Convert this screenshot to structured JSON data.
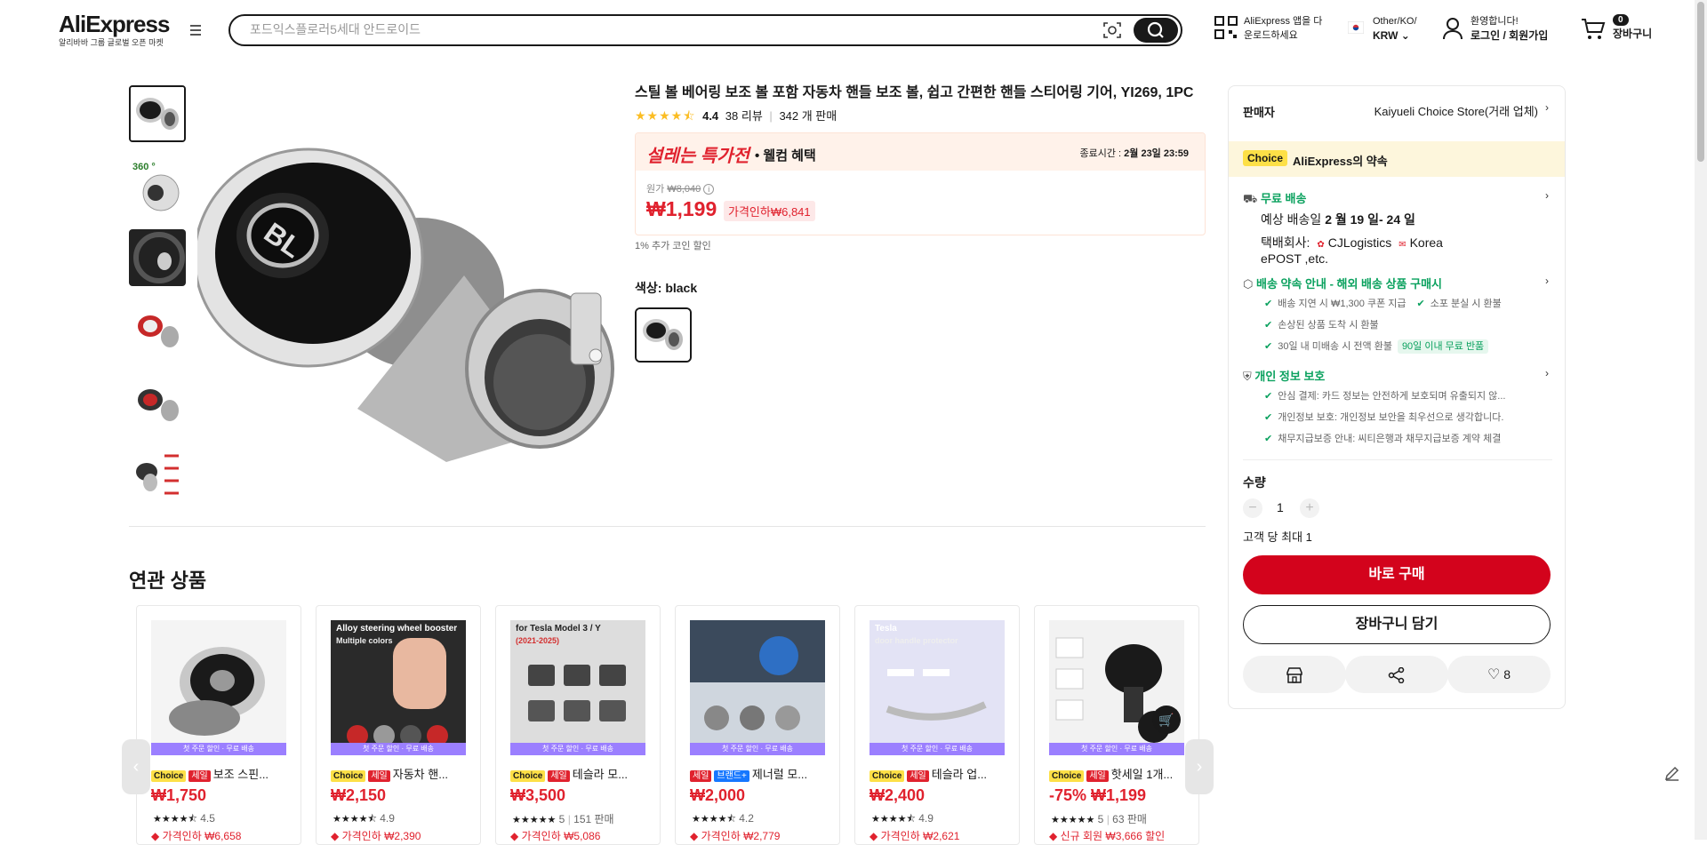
{
  "header": {
    "logo": "AliExpress",
    "logo_sub": "알리바바 그룹 글로벌 오픈 마켓",
    "search_placeholder": "포드익스플로러5세대 안드로이드",
    "app_line1": "AliExpress 앱을 다",
    "app_line2": "운로드하세요",
    "locale_line1": "Other/KO/",
    "locale_line2": "KRW",
    "account_line1": "환영합니다!",
    "account_line2": "로그인 / 회원가입",
    "cart_count": "0",
    "cart_label": "장바구니"
  },
  "product": {
    "title": "스틸 볼 베어링 보조 볼 포함 자동차 핸들 보조 볼, 쉽고 간편한 핸들 스티어링 기어, YI269, 1PC",
    "rating": "4.4",
    "stars": "★★★★⯪",
    "reviews": "38 리뷰",
    "sold": "342 개 판매",
    "promo_logo": "설레는 특가전",
    "promo_tag": "• 웰컴 혜택",
    "promo_end_label": "종료시간 :",
    "promo_end_time": "2월 23일 23:59",
    "original_label": "원가",
    "original_price": "₩8,040",
    "price": "₩1,199",
    "discount": "가격인하₩6,841",
    "coin": "1% 추가 코인 할인",
    "color_label": "색상:",
    "color_value": "black"
  },
  "panel": {
    "seller_label": "판매자",
    "seller_name": "Kaiyueli Choice Store(거래 업체)",
    "choice_badge": "Choice",
    "promise": "AliExpress의 약속",
    "shipping_title": "무료 배송",
    "eta_label": "예상 배송일",
    "eta": "2 월 19 일- 24 일",
    "carrier_label": "택배회사:",
    "carrier1": "CJLogistics",
    "carrier2": "Korea",
    "carrier3": "ePOST ,etc.",
    "guarantee_title": "배송 약속 안내 - 해외 배송 상품 구매시",
    "g1": "배송 지연 시 ₩1,300 쿠폰 지급",
    "g2": "소포 분실 시 환불",
    "g3": "손상된 상품 도착 시 환불",
    "g4": "30일 내 미배송 시 전액 환불",
    "g4_tag": "90일 이내 무료 반품",
    "privacy_title": "개인 정보 보호",
    "p1": "안심 결제: 카드 정보는 안전하게 보호되며 유출되지 않...",
    "p2": "개인정보 보호: 개인정보 보안을 최우선으로 생각합니다.",
    "p3": "채무지급보증 안내: 씨티은행과 채무지급보증 계약 체결",
    "qty_label": "수량",
    "qty_minus": "−",
    "qty_value": "1",
    "qty_plus": "+",
    "qty_limit": "고객 당 최대 1",
    "buy_now": "바로 구매",
    "add_cart": "장바구니 담기",
    "wish_count": "8"
  },
  "related": {
    "title": "연관 상품",
    "strip": "첫 주문 할인 · 무료 배송",
    "items": [
      {
        "badges": [
          "Choice",
          "세일"
        ],
        "name": "보조 스핀...",
        "price": "₩1,750",
        "stars": "★★★★⯪",
        "rating": "4.5",
        "sold": "",
        "sub": "가격인하 ₩6,658"
      },
      {
        "badges": [
          "Choice",
          "세일"
        ],
        "name": "자동차 핸...",
        "price": "₩2,150",
        "stars": "★★★★⯪",
        "rating": "4.9",
        "sold": "",
        "sub": "가격인하 ₩2,390"
      },
      {
        "badges": [
          "Choice",
          "세일"
        ],
        "name": "테슬라 모...",
        "price": "₩3,500",
        "stars": "★★★★★",
        "rating": "5",
        "sold": "151 판매",
        "sub": "가격인하 ₩5,086"
      },
      {
        "badges": [
          "세일",
          "브랜드+"
        ],
        "name": "제너럴 모...",
        "price": "₩2,000",
        "stars": "★★★★⯪",
        "rating": "4.2",
        "sold": "",
        "sub": "가격인하 ₩2,779"
      },
      {
        "badges": [
          "Choice",
          "세일"
        ],
        "name": "테슬라 업...",
        "price": "₩2,400",
        "stars": "★★★★⯪",
        "rating": "4.9",
        "sold": "",
        "sub": "가격인하 ₩2,621"
      },
      {
        "badges": [
          "Choice",
          "세일"
        ],
        "name": "핫세일 1개...",
        "price": "-75% ₩1,199",
        "stars": "★★★★★",
        "rating": "5",
        "sold": "63 판매",
        "sub": "신규 회원 ₩3,666 할인"
      }
    ],
    "img_texts": [
      "",
      "Alloy steering wheel booster",
      "for Tesla Model 3 / Y",
      "",
      "Tesla",
      ""
    ],
    "img_texts2": [
      "",
      "Multiple colors",
      "(2021-2025)",
      "",
      "door handle protector",
      ""
    ]
  },
  "colors": {
    "brand_red": "#e0222e",
    "buy_red": "#d3031c",
    "green": "#0aa15e",
    "choice_yellow": "#fde047"
  }
}
